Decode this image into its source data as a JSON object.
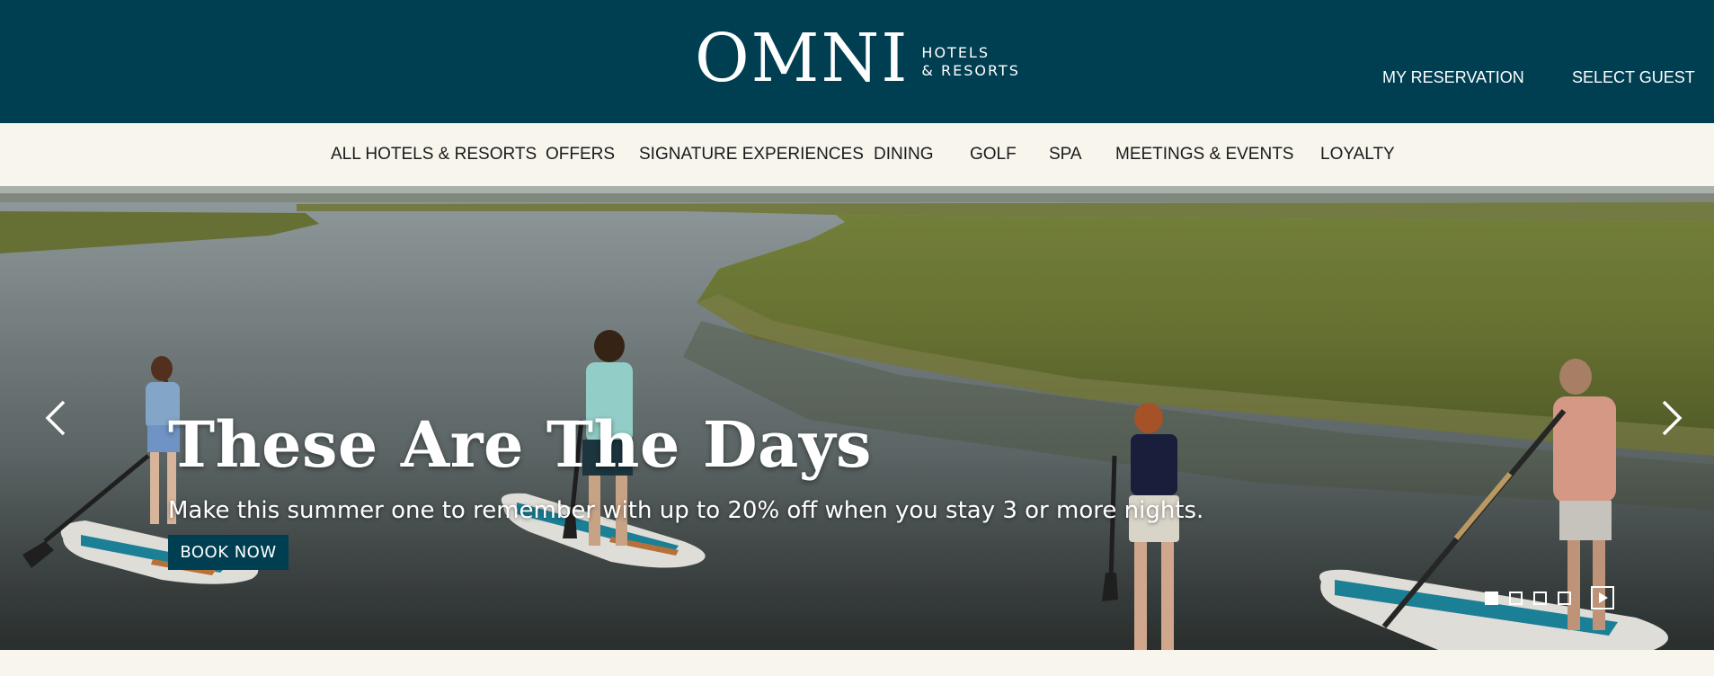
{
  "header": {
    "logo_word": "OMNI",
    "logo_line1": "HOTELS",
    "logo_line2": "& RESORTS",
    "my_reservation": "MY RESERVATION",
    "select_guest": "SELECT GUEST"
  },
  "nav": {
    "items": [
      {
        "label": "ALL HOTELS & RESORTS"
      },
      {
        "label": "OFFERS"
      },
      {
        "label": "SIGNATURE EXPERIENCES"
      },
      {
        "label": "DINING"
      },
      {
        "label": "GOLF"
      },
      {
        "label": "SPA"
      },
      {
        "label": "MEETINGS & EVENTS"
      },
      {
        "label": "LOYALTY"
      }
    ]
  },
  "hero": {
    "title": "These Are The Days",
    "subtitle": "Make this summer one to remember with up to 20% off when you stay 3 or more nights.",
    "cta": "BOOK NOW",
    "slide_count": 4,
    "active_slide": 1,
    "prev_icon": "chevron-left-icon",
    "next_icon": "chevron-right-icon",
    "play_icon": "play-icon"
  },
  "colors": {
    "brand": "#003e51",
    "nav_bg": "#f8f5ed",
    "text_dark": "#1a1a1a",
    "white": "#ffffff"
  }
}
